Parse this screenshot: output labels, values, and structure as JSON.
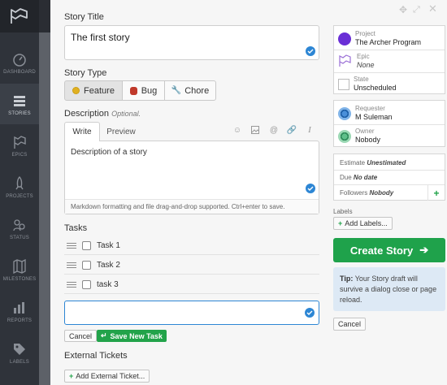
{
  "rail": {
    "items": [
      {
        "label": "DASHBOARD",
        "icon": "dashboard-icon"
      },
      {
        "label": "STORIES",
        "icon": "stories-icon"
      },
      {
        "label": "EPICS",
        "icon": "epics-icon"
      },
      {
        "label": "PROJECTS",
        "icon": "projects-icon"
      },
      {
        "label": "STATUS",
        "icon": "status-icon"
      },
      {
        "label": "MILESTONES",
        "icon": "milestones-icon"
      },
      {
        "label": "REPORTS",
        "icon": "reports-icon"
      },
      {
        "label": "LABELS",
        "icon": "labels-icon"
      }
    ],
    "active_index": 1
  },
  "story": {
    "title_label": "Story Title",
    "title_value": "The first story",
    "type_label": "Story Type",
    "types": [
      {
        "label": "Feature",
        "icon": "feature-icon",
        "selected": true
      },
      {
        "label": "Bug",
        "icon": "bug-icon",
        "selected": false
      },
      {
        "label": "Chore",
        "icon": "wrench-icon",
        "selected": false
      }
    ],
    "description_label": "Description",
    "description_optional": "Optional.",
    "tabs": [
      "Write",
      "Preview"
    ],
    "description_value": "Description of a story",
    "description_hint": "Markdown formatting and file drag-and-drop supported. Ctrl+enter to save."
  },
  "tasks": {
    "label": "Tasks",
    "items": [
      "Task 1",
      "Task 2",
      "task 3"
    ],
    "cancel_label": "Cancel",
    "save_label": "Save New Task"
  },
  "external": {
    "label": "External Tickets",
    "add_label": "Add External Ticket..."
  },
  "sidebar": {
    "project_label": "Project",
    "project_value": "The Archer Program",
    "epic_label": "Epic",
    "epic_value": "None",
    "state_label": "State",
    "state_value": "Unscheduled",
    "requester_label": "Requester",
    "requester_value": "M Suleman",
    "owner_label": "Owner",
    "owner_value": "Nobody",
    "estimate_label": "Estimate",
    "estimate_value": "Unestimated",
    "due_label": "Due",
    "due_value": "No date",
    "followers_label": "Followers",
    "followers_value": "Nobody",
    "labels_label": "Labels",
    "add_labels": "Add Labels...",
    "create_label": "Create Story",
    "tip_bold": "Tip:",
    "tip_text": "Your Story draft will survive a dialog close or page reload.",
    "cancel_label": "Cancel"
  },
  "colors": {
    "accent_blue": "#2d86d4",
    "create_green": "#1fa24b",
    "project_purple": "#6a2fd6"
  }
}
